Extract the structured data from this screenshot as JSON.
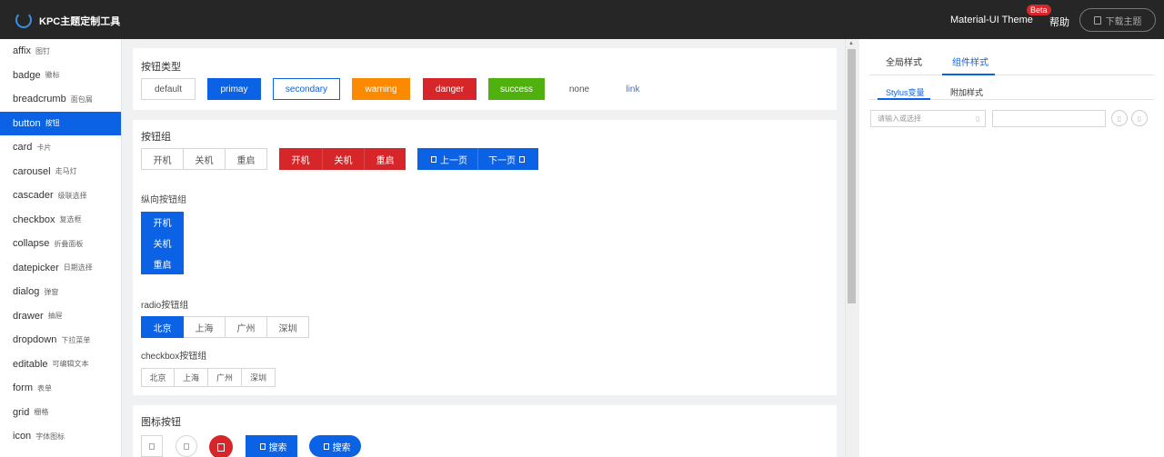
{
  "header": {
    "title": "KPC主题定制工具",
    "theme_name": "Material-UI Theme",
    "beta_badge": "Beta",
    "help": "帮助",
    "download": "下载主题"
  },
  "sidebar": {
    "items": [
      {
        "en": "affix",
        "zh": "图钉"
      },
      {
        "en": "badge",
        "zh": "徽标"
      },
      {
        "en": "breadcrumb",
        "zh": "面包屑"
      },
      {
        "en": "button",
        "zh": "按钮"
      },
      {
        "en": "card",
        "zh": "卡片"
      },
      {
        "en": "carousel",
        "zh": "走马灯"
      },
      {
        "en": "cascader",
        "zh": "级联选择"
      },
      {
        "en": "checkbox",
        "zh": "复选框"
      },
      {
        "en": "collapse",
        "zh": "折叠面板"
      },
      {
        "en": "datepicker",
        "zh": "日期选择"
      },
      {
        "en": "dialog",
        "zh": "弹窗"
      },
      {
        "en": "drawer",
        "zh": "抽屉"
      },
      {
        "en": "dropdown",
        "zh": "下拉菜单"
      },
      {
        "en": "editable",
        "zh": "可编辑文本"
      },
      {
        "en": "form",
        "zh": "表单"
      },
      {
        "en": "grid",
        "zh": "栅格"
      },
      {
        "en": "icon",
        "zh": "字体图标"
      }
    ],
    "active_index": 3
  },
  "button_types": {
    "title": "按钮类型",
    "buttons": [
      "default",
      "primay",
      "secondary",
      "warning",
      "danger",
      "success",
      "none",
      "link"
    ]
  },
  "button_group": {
    "title": "按钮组",
    "group1": [
      "开机",
      "关机",
      "重启"
    ],
    "group2": [
      "开机",
      "关机",
      "重启"
    ],
    "prev": "上一页",
    "next": "下一页",
    "vertical_title": "纵向按钮组",
    "vertical": [
      "开机",
      "关机",
      "重启"
    ],
    "radio_title": "radio按钮组",
    "radio": [
      "北京",
      "上海",
      "广州",
      "深圳"
    ],
    "checkbox_title": "checkbox按钮组",
    "checkbox": [
      "北京",
      "上海",
      "广州",
      "深圳"
    ]
  },
  "icon_buttons": {
    "title": "图标按钮",
    "search": "搜索",
    "search_round": "搜索"
  },
  "right_panel": {
    "tabs": [
      "全局样式",
      "组件样式"
    ],
    "subtabs": [
      "Stylus变量",
      "附加样式"
    ],
    "select_placeholder": "请输入或选择"
  },
  "colors": {
    "primary": "#0b62e4",
    "warning": "#fb8a00",
    "danger": "#d7262a",
    "success": "#50b10e",
    "header_bg": "#262626"
  }
}
